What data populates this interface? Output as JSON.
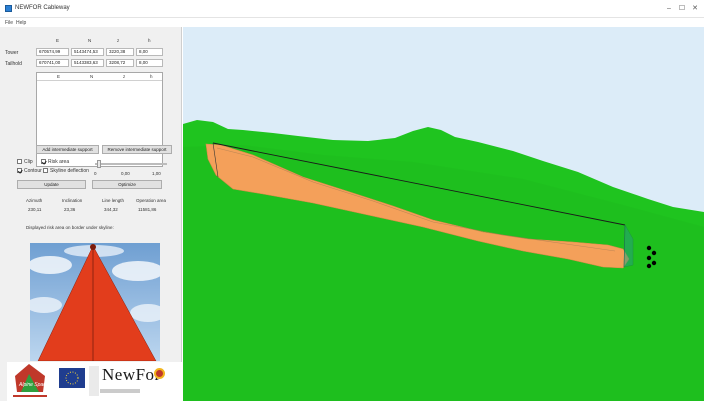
{
  "window": {
    "title": "NEWFOR Cableway",
    "controls": [
      "–",
      "☐",
      "✕"
    ]
  },
  "menu": [
    "File",
    "Help"
  ],
  "coords": {
    "headers": [
      "E",
      "N",
      "z",
      "h"
    ],
    "rows": [
      {
        "label": "Tower",
        "E": "670574,99",
        "N": "5143474,53",
        "z": "3220,38",
        "h": "8,00"
      },
      {
        "label": "Tailhold",
        "E": "670741,00",
        "N": "5143383,63",
        "z": "3208,72",
        "h": "8,00"
      }
    ]
  },
  "supports_table": {
    "headers": [
      "E",
      "N",
      "z",
      "h"
    ]
  },
  "buttons": {
    "add_support": "Add intermediate support",
    "remove_support": "Remove intermediate support",
    "update": "Update",
    "optimize": "Optimize"
  },
  "options": {
    "clip": "Clip",
    "clip_checked": false,
    "risk_area": "Risk area",
    "risk_area_checked": true,
    "contour": "Contour",
    "contour_checked": true,
    "skyline_deflection": "Skyline deflection",
    "skyline_deflection_checked": false
  },
  "slider": {
    "min_label": "0",
    "mid_label": "0,00",
    "max_label": "1,00",
    "value": 0.05
  },
  "results": {
    "headers": [
      "Azimuth",
      "Inclination",
      "Line length",
      "Operation area"
    ],
    "values": [
      "230,11",
      "23,36",
      "344,32",
      "11581,86"
    ]
  },
  "info_text": "Displayed risk area on border under skyline:",
  "logos": {
    "alpine_space": "Alpine Space",
    "newfor": "NewFor"
  },
  "colors": {
    "terrain": "#1fc41f",
    "sky": "#dcecf8",
    "risk_area": "#f4a05a",
    "preview_triangle": "#e23d1c",
    "panel": "#f0f0f0"
  }
}
